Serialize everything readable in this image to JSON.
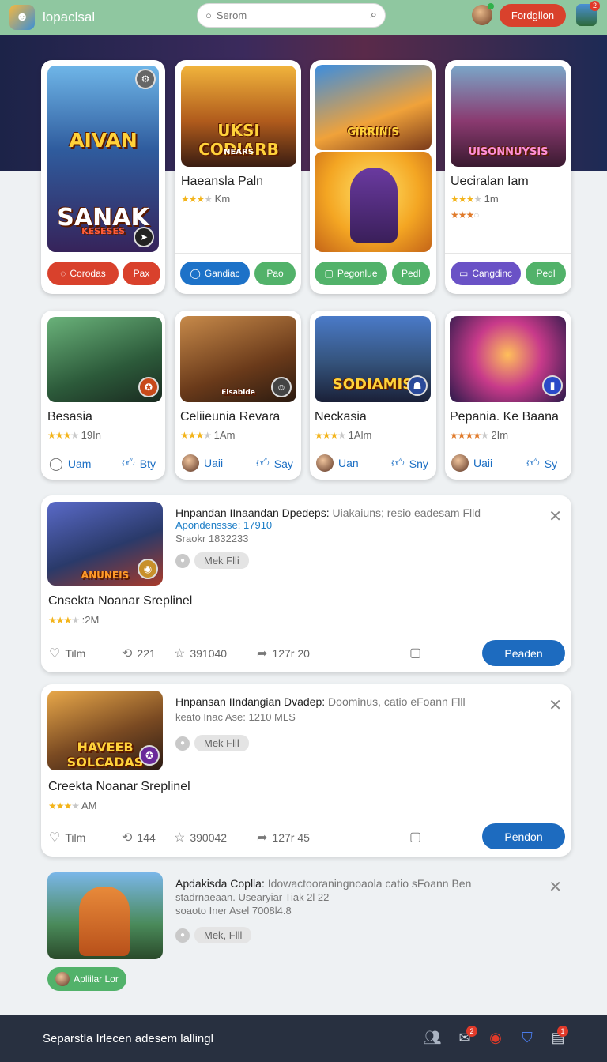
{
  "header": {
    "title": "lopaclsal",
    "search_placeholder": "Serom",
    "follow_label": "Fordgllon",
    "notif_count": "2"
  },
  "row1": [
    {
      "art_text_1": "AIVAN",
      "art_text_2": "SANAK",
      "art_text_3": "KESESES",
      "btn1": "Corodas",
      "btn2": "Pax"
    },
    {
      "art_text": "UKSI CODIARB",
      "art_sub": "NEARS",
      "title": "Haeansla Paln",
      "rating": "Km",
      "btn1": "Gandiac",
      "btn2": "Pao"
    },
    {
      "art_text": "GIRRINIS",
      "btn1": "Pegonlue",
      "btn2": "Pedl"
    },
    {
      "art_text": "UISONNUYSIS",
      "title": "Ueciralan Iam",
      "rating": "1m",
      "btn1": "Cangdinc",
      "btn2": "Pedl"
    }
  ],
  "row2": [
    {
      "title": "Besasia",
      "rating": "19In",
      "left": "Uam",
      "right": "Bty"
    },
    {
      "art_text": "Elsabide",
      "title": "Celiieunia Revara",
      "rating": "1Am",
      "left": "Uaii",
      "right": "Say"
    },
    {
      "art_text": "SODIAMIS",
      "title": "Neckasia",
      "rating": "1Alm",
      "left": "Uan",
      "right": "Sny"
    },
    {
      "title": "Pepania. Ke Baana",
      "rating": "2Im",
      "left": "Uaii",
      "right": "Sy"
    }
  ],
  "posts": [
    {
      "head_bold": "Hnpandan IInaandan Dpedeps:",
      "head_rest": "Uiakaiuns;  resio eadesam Flld",
      "line1": "Apondenssse: 17910",
      "line2": "Sraokr 1832233",
      "chip": "Mek  Flli",
      "art_text": "ANUNEIS",
      "name": "Cnsekta Noanar Sreplinel",
      "rating": ":2M",
      "act1": "Tilm",
      "act2": "221",
      "act3": "391040",
      "act4": "127r 20",
      "cta": "Peaden"
    },
    {
      "head_bold": "Hnpansan IIndangian Dvadep:",
      "head_rest": "Doominus, catio eFoann Flll",
      "line1": "keato Inac  Ase: 1210 MLS",
      "chip": "Mek  Flll",
      "art_text": "HAVEEB SOLCADAS",
      "name": "Creekta Noanar Sreplinel",
      "rating": "AM",
      "act1": "Tilm",
      "act2": "144",
      "act3": "390042",
      "act4": "127r 45",
      "cta": "Pendon"
    },
    {
      "head_bold": "Apdakisda Coplla:",
      "head_rest": "Idowactooraningnoaola  catio sFoann Ben",
      "line1": "stadrnaeaan. Usearyiar Tiak 2l 22",
      "line2": "soaoto Iner Asel 7008l4.8",
      "chip": "Mek, Flll",
      "pill": "Apliilar Lor"
    }
  ],
  "bottom": {
    "text": "Separstla Irlecen adesem lallingl",
    "badge1": "2",
    "badge2": "1"
  }
}
